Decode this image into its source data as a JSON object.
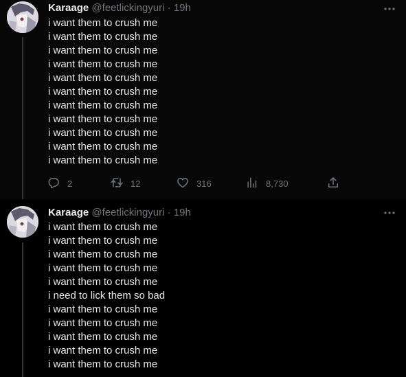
{
  "colors": {
    "background": "#000000",
    "first_tweet_bg": "#080808",
    "text": "#e7e9ea",
    "muted": "#71767b"
  },
  "tweets": [
    {
      "author_name": "Karaage",
      "handle": "@feetlickingyuri",
      "separator": "·",
      "time": "19h",
      "lines": [
        "i want them to crush me",
        "i want them to crush me",
        "i want them to crush me",
        "i want them to crush me",
        "i want them to crush me",
        "i want them to crush me",
        "i want them to crush me",
        "i want them to crush me",
        "i want them to crush me",
        "i want them to crush me",
        "i want them to crush me"
      ],
      "actions": {
        "replies": "2",
        "retweets": "12",
        "likes": "316",
        "views": "8,730"
      }
    },
    {
      "author_name": "Karaage",
      "handle": "@feetlickingyuri",
      "separator": "·",
      "time": "19h",
      "lines": [
        "i want them to crush me",
        "i want them to crush me",
        "i want them to crush me",
        "i want them to crush me",
        "i want them to crush me",
        "i need to lick them so bad",
        "i want them to crush me",
        "i want them to crush me",
        "i want them to crush me",
        "i want them to crush me",
        "i want them to crush me"
      ]
    }
  ],
  "icons": [
    "avatar-image",
    "more-icon",
    "reply-icon",
    "retweet-icon",
    "like-icon",
    "views-icon",
    "share-icon"
  ]
}
